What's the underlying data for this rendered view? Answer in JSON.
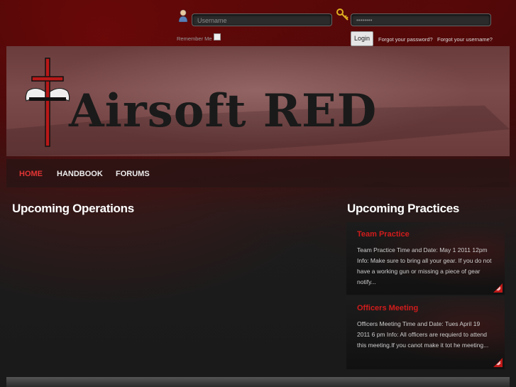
{
  "login": {
    "username_placeholder": "Username",
    "password_value": "••••••••",
    "remember_label": "Remember Me",
    "login_button": "Login",
    "forgot_password": "Forgot your password?",
    "forgot_username": "Forgot your username?"
  },
  "banner": {
    "title": "Airsoft RED"
  },
  "nav": {
    "items": [
      {
        "label": "HOME"
      },
      {
        "label": "HANDBOOK"
      },
      {
        "label": "FORUMS"
      }
    ]
  },
  "main": {
    "operations_heading": "Upcoming Operations",
    "practices_heading": "Upcoming Practices",
    "practices": [
      {
        "title": "Team Practice",
        "body": "Team Practice Time and Date: May 1 2011 12pm Info: Make sure to bring all your gear. If you do not have a working gun or missing a piece of gear notify..."
      },
      {
        "title": "Officers Meeting",
        "body": "Officers Meeting Time and Date: Tues April 19 2011 6 pm Info: All officers are requierd to attend this meeting.If you canot make it tot he meeting..."
      }
    ]
  },
  "colors": {
    "accent": "#d11c1c",
    "nav_active": "#e23434"
  }
}
